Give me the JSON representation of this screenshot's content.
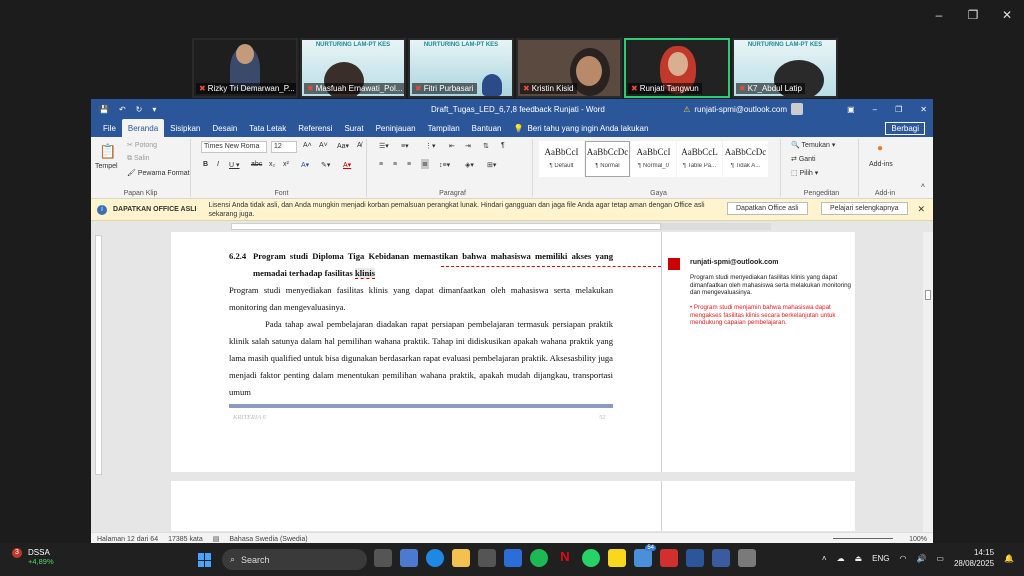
{
  "zoom_window": {
    "minimize": "–",
    "maximize": "❐",
    "close": "✕"
  },
  "participants": [
    {
      "name": "Rizky Tri Demarwan_P...",
      "muted": true,
      "banner": ""
    },
    {
      "name": "Masfuah Ernawati_Pol...",
      "muted": true,
      "banner": "NURTURING LAM-PT KES"
    },
    {
      "name": "Fitri Purbasari",
      "muted": true,
      "banner": "NURTURING LAM-PT KES"
    },
    {
      "name": "Kristin Kisid",
      "muted": true,
      "banner": ""
    },
    {
      "name": "Runjati Tangwun",
      "muted": true,
      "banner": "",
      "active": true
    },
    {
      "name": "K7_Abdul Latip",
      "muted": true,
      "banner": "NURTURING LAM-PT KES"
    }
  ],
  "word": {
    "doc_title": "Draft_Tugas_LED_6,7,8 feedback Runjati - Word",
    "account": "runjati-spmi@outlook.com",
    "tabs": [
      "File",
      "Beranda",
      "Sisipkan",
      "Desain",
      "Tata Letak",
      "Referensi",
      "Surat",
      "Peninjauan",
      "Tampilan",
      "Bantuan"
    ],
    "active_tab": "Beranda",
    "tell_me": "Beri tahu yang ingin Anda lakukan",
    "share": "Berbagi",
    "ribbon": {
      "clipboard": {
        "paste": "Tempel",
        "cut": "Potong",
        "copy": "Salin",
        "format_painter": "Pewarna Format",
        "label": "Papan Klip"
      },
      "font": {
        "name": "Times New Roma",
        "size": "12",
        "label": "Font"
      },
      "paragraph": {
        "label": "Paragraf"
      },
      "styles": {
        "label": "Gaya",
        "items": [
          {
            "preview": "AaBbCcI",
            "name": "¶ Default"
          },
          {
            "preview": "AaBbCcDc",
            "name": "¶ Normal"
          },
          {
            "preview": "AaBbCcI",
            "name": "¶ Normal_0"
          },
          {
            "preview": "AaBbCcL",
            "name": "¶ Table Pa..."
          },
          {
            "preview": "AaBbCcDc",
            "name": "¶ Tidak A..."
          }
        ]
      },
      "editing": {
        "find": "Temukan",
        "replace": "Ganti",
        "select": "Pilih",
        "label": "Pengeditan"
      },
      "addins": {
        "button": "Add-ins",
        "label": "Add-in"
      }
    },
    "infobar": {
      "header": "DAPATKAN OFFICE ASLI",
      "message": "Lisensi Anda tidak asli, dan Anda mungkin menjadi korban pemalsuan perangkat lunak. Hindari gangguan dan jaga file Anda agar tetap aman dengan Office asli sekarang juga.",
      "btn_primary": "Dapatkan Office asli",
      "btn_secondary": "Pelajari selengkapnya"
    },
    "document": {
      "heading_num": "6.2.4",
      "heading_text": "Program studi Diploma Tiga Kebidanan memastikan bahwa mahasiswa memiliki akses yang memadai terhadap fasilitas",
      "heading_highlight": "klinis",
      "para1": "Program studi menyediakan fasilitas klinis yang dapat dimanfaatkan oleh mahasiswa serta melakukan monitoring dan mengevaluasinya.",
      "para2": "Pada tahap awal pembelajaran diadakan rapat persiapan pembelajaran termasuk persiapan praktik klinik salah satunya dalam hal pemilihan wahana praktik. Tahap ini didiskusikan apakah wahana praktik yang lama masih qualified untuk bisa digunakan berdasarkan rapat evaluasi pembelajaran praktik. Aksesasbility juga menjadi faktor penting dalam menentukan pemilihan wahana praktik, apakah mudah dijangkau, transportasi umum",
      "footer_left": "KRITERIA 6",
      "footer_right": "52"
    },
    "comment": {
      "author": "runjati-spmi@outlook.com",
      "body": "Program studi menyediakan fasilitas klinis yang dapat dimanfaatkan oleh mahasiswa serta melakukan monitoring dan mengevaluasinya.",
      "reply": "• Program studi menjamin bahwa mahasiswa dapat mengakses fasilitas klinis secara berkelanjutan untuk mendukung capaian pembelajaran."
    },
    "status": {
      "page": "Halaman 12 dari 64",
      "words": "17385 kata",
      "language": "Bahasa Swedia (Swedia)",
      "zoom": "100%"
    }
  },
  "taskbar": {
    "stock_symbol": "DSSA",
    "stock_change": "+4,89%",
    "notification_count": "3",
    "search_label": "Search",
    "app_badge": "54",
    "lang": "ENG",
    "time": "14:15",
    "date": "28/08/2025"
  }
}
